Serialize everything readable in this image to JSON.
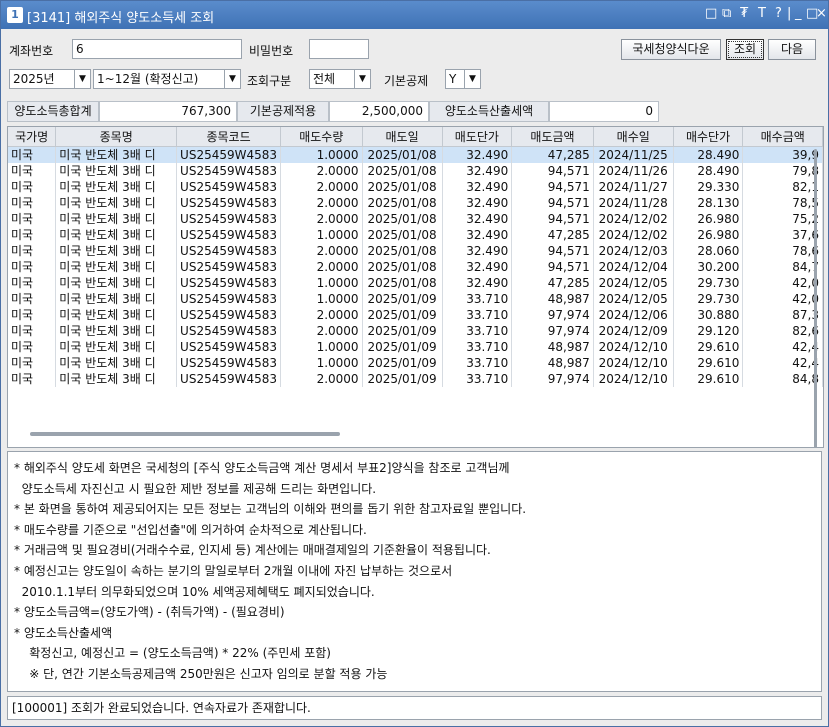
{
  "window": {
    "number": "1",
    "title": "[3141] 해외주식 양도소득세 조회",
    "controls": [
      "□",
      "⧉",
      "₮",
      "T",
      "?",
      "|",
      "_",
      "□",
      "×"
    ]
  },
  "account": {
    "label": "계좌번호",
    "value": "6",
    "pw_label": "비밀번호",
    "pw_value": ""
  },
  "buttons": {
    "nts_download": "국세청양식다운",
    "query": "조회",
    "next": "다음"
  },
  "filters": {
    "year": "2025년",
    "period": "1~12월 (확정신고)",
    "query_type_label": "조회구분",
    "query_type": "전체",
    "basic_deduction_label": "기본공제",
    "basic_deduction": "Y"
  },
  "summary": {
    "total_label": "양도소득총합계",
    "total_value": "767,300",
    "deduction_label": "기본공제적용",
    "deduction_value": "2,500,000",
    "tax_label": "양도소득산출세액",
    "tax_value": "0"
  },
  "table": {
    "headers": [
      "국가명",
      "종목명",
      "종목코드",
      "매도수량",
      "매도일",
      "매도단가",
      "매도금액",
      "매수일",
      "매수단가",
      "매수금액"
    ],
    "rows": [
      [
        "미국",
        "미국 반도체 3배 디",
        "US25459W4583",
        "1.0000",
        "2025/01/08",
        "32.490",
        "47,285",
        "2024/11/25",
        "28.490",
        "39,9"
      ],
      [
        "미국",
        "미국 반도체 3배 디",
        "US25459W4583",
        "2.0000",
        "2025/01/08",
        "32.490",
        "94,571",
        "2024/11/26",
        "28.490",
        "79,8"
      ],
      [
        "미국",
        "미국 반도체 3배 디",
        "US25459W4583",
        "2.0000",
        "2025/01/08",
        "32.490",
        "94,571",
        "2024/11/27",
        "29.330",
        "82,1"
      ],
      [
        "미국",
        "미국 반도체 3배 디",
        "US25459W4583",
        "2.0000",
        "2025/01/08",
        "32.490",
        "94,571",
        "2024/11/28",
        "28.130",
        "78,5"
      ],
      [
        "미국",
        "미국 반도체 3배 디",
        "US25459W4583",
        "2.0000",
        "2025/01/08",
        "32.490",
        "94,571",
        "2024/12/02",
        "26.980",
        "75,2"
      ],
      [
        "미국",
        "미국 반도체 3배 디",
        "US25459W4583",
        "1.0000",
        "2025/01/08",
        "32.490",
        "47,285",
        "2024/12/02",
        "26.980",
        "37,6"
      ],
      [
        "미국",
        "미국 반도체 3배 디",
        "US25459W4583",
        "2.0000",
        "2025/01/08",
        "32.490",
        "94,571",
        "2024/12/03",
        "28.060",
        "78,6"
      ],
      [
        "미국",
        "미국 반도체 3배 디",
        "US25459W4583",
        "2.0000",
        "2025/01/08",
        "32.490",
        "94,571",
        "2024/12/04",
        "30.200",
        "84,7"
      ],
      [
        "미국",
        "미국 반도체 3배 디",
        "US25459W4583",
        "1.0000",
        "2025/01/08",
        "32.490",
        "47,285",
        "2024/12/05",
        "29.730",
        "42,0"
      ],
      [
        "미국",
        "미국 반도체 3배 디",
        "US25459W4583",
        "1.0000",
        "2025/01/09",
        "33.710",
        "48,987",
        "2024/12/05",
        "29.730",
        "42,0"
      ],
      [
        "미국",
        "미국 반도체 3배 디",
        "US25459W4583",
        "2.0000",
        "2025/01/09",
        "33.710",
        "97,974",
        "2024/12/06",
        "30.880",
        "87,3"
      ],
      [
        "미국",
        "미국 반도체 3배 디",
        "US25459W4583",
        "2.0000",
        "2025/01/09",
        "33.710",
        "97,974",
        "2024/12/09",
        "29.120",
        "82,6"
      ],
      [
        "미국",
        "미국 반도체 3배 디",
        "US25459W4583",
        "1.0000",
        "2025/01/09",
        "33.710",
        "48,987",
        "2024/12/10",
        "29.610",
        "42,4"
      ],
      [
        "미국",
        "미국 반도체 3배 디",
        "US25459W4583",
        "1.0000",
        "2025/01/09",
        "33.710",
        "48,987",
        "2024/12/10",
        "29.610",
        "42,4"
      ],
      [
        "미국",
        "미국 반도체 3배 디",
        "US25459W4583",
        "2.0000",
        "2025/01/09",
        "33.710",
        "97,974",
        "2024/12/10",
        "29.610",
        "84,8"
      ]
    ]
  },
  "notes": [
    "* 해외주식 양도세 화면은 국세청의 [주식 양도소득금액 계산 명세서 부표2]양식을 참조로 고객님께",
    "  양도소득세 자진신고 시 필요한 제반 정보를 제공해 드리는 화면입니다.",
    "* 본 화면을 통하여 제공되어지는 모든 정보는 고객님의 이해와 편의를 돕기 위한 참고자료일 뿐입니다.",
    "* 매도수량를 기준으로 \"선입선출\"에 의거하여 순차적으로 계산됩니다.",
    "* 거래금액 및 필요경비(거래수수료, 인지세 등) 계산에는 매매결제일의 기준환율이 적용됩니다.",
    "* 예정신고는 양도일이 속하는 분기의 말일로부터 2개월 이내에 자진 납부하는 것으로서",
    "  2010.1.1부터 의무화되었으며 10% 세액공제혜택도 폐지되었습니다.",
    "* 양도소득금액=(양도가액) - (취득가액) - (필요경비)",
    "* 양도소득산출세액",
    "    확정신고, 예정신고 = (양도소득금액) * 22% (주민세 포함)",
    "    ※ 단, 연간 기본소득공제금액 250만원은 신고자 임의로 분할 적용 가능"
  ],
  "status": "[100001] 조회가 완료되었습니다. 연속자료가 존재합니다."
}
